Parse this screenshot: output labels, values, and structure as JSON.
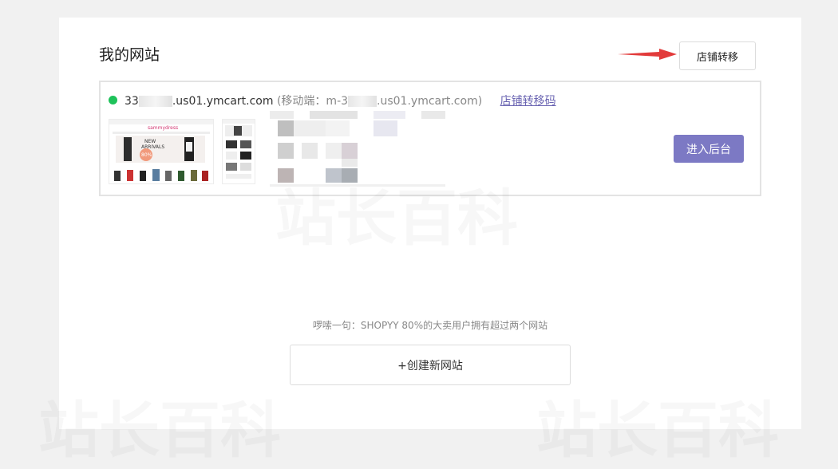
{
  "page": {
    "title": "我的网站",
    "transfer_button": "店铺转移",
    "hint": "啰嗦一句：SHOPYY 80%的大卖用户拥有超过两个网站",
    "create_button": "+创建新网站"
  },
  "site": {
    "status_color": "#1ec25a",
    "domain_prefix": "33",
    "domain_suffix": ".us01.ymcart.com",
    "mobile_prefix": "(移动端：m-3",
    "mobile_suffix": ".us01.ymcart.com)",
    "transfer_code_link": "店铺转移码",
    "enter_button": "进入后台",
    "thumb": {
      "logo": "sammydress",
      "banner_line1": "NEW",
      "banner_line2": "ARRIVALS",
      "badge": "80%"
    }
  },
  "colors": {
    "accent": "#7c79c4",
    "arrow": "#e23a3a",
    "link": "#6a64b2"
  },
  "watermark": "站长百科"
}
